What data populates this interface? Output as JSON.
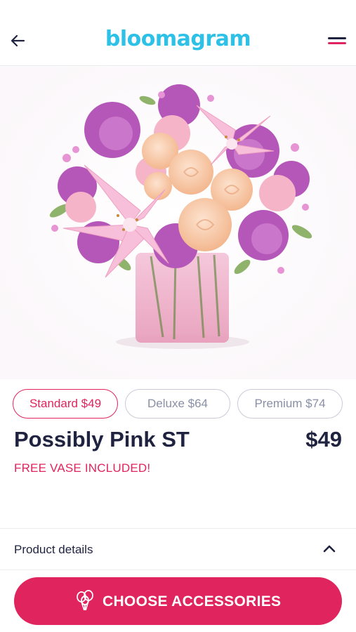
{
  "header": {
    "logo": "bloomagram",
    "back_icon": "arrow-left-icon",
    "menu_icon": "hamburger-menu-icon"
  },
  "product": {
    "sizes": [
      {
        "label": "Standard $49",
        "selected": true
      },
      {
        "label": "Deluxe $64",
        "selected": false
      },
      {
        "label": "Premium $74",
        "selected": false
      }
    ],
    "name": "Possibly Pink ST",
    "price": "$49",
    "promo": "FREE VASE INCLUDED!"
  },
  "details": {
    "label": "Product details",
    "icon": "chevron-up-icon"
  },
  "cta": {
    "label": "CHOOSE ACCESSORIES",
    "icon": "balloons-icon"
  },
  "colors": {
    "brand_cyan": "#2ec1e8",
    "accent_pink": "#e0245e",
    "navy": "#1f2340"
  }
}
